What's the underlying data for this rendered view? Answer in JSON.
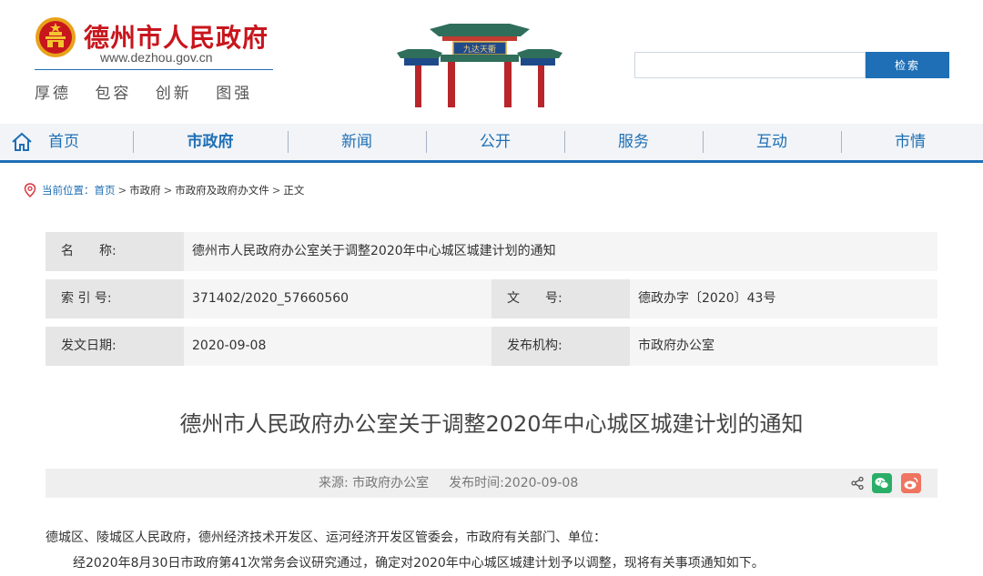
{
  "header": {
    "site_title": "德州市人民政府",
    "site_url": "www.dezhou.gov.cn",
    "motto": "厚德 包容 创新 图强",
    "gate_plaque": "九达天衢"
  },
  "search": {
    "placeholder": "",
    "button_label": "检索"
  },
  "nav": {
    "items": [
      {
        "label": "首页"
      },
      {
        "label": "市政府"
      },
      {
        "label": "新闻"
      },
      {
        "label": "公开"
      },
      {
        "label": "服务"
      },
      {
        "label": "互动"
      },
      {
        "label": "市情"
      }
    ],
    "active_index": 1
  },
  "breadcrumb": {
    "label": "当前位置：",
    "items": [
      "首页",
      "市政府",
      "市政府及政府办文件",
      "正文"
    ],
    "separator": ">"
  },
  "info": {
    "name_label": "名　　称:",
    "name_value": "德州市人民政府办公室关于调整2020年中心城区城建计划的通知",
    "index_label": "索 引 号:",
    "index_value": "371402/2020_57660560",
    "docno_label": "文　　号:",
    "docno_value": "德政办字〔2020〕43号",
    "date_label": "发文日期:",
    "date_value": "2020-09-08",
    "org_label": "发布机构:",
    "org_value": "市政府办公室"
  },
  "article": {
    "title": "德州市人民政府办公室关于调整2020年中心城区城建计划的通知",
    "source": "来源: 市政府办公室",
    "publish_time": "发布时间:2020-09-08",
    "paragraph1": "德城区、陵城区人民政府，德州经济技术开发区、运河经济开发区管委会，市政府有关部门、单位：",
    "paragraph2": "经2020年8月30日市政府第41次常务会议研究通过，确定对2020年中心城区城建计划予以调整，现将有关事项通知如下。"
  },
  "colors": {
    "brand_red": "#c8161d",
    "brand_blue": "#1e6fb5",
    "wechat_green": "#2aae67",
    "weibo_orange": "#ef7461"
  }
}
